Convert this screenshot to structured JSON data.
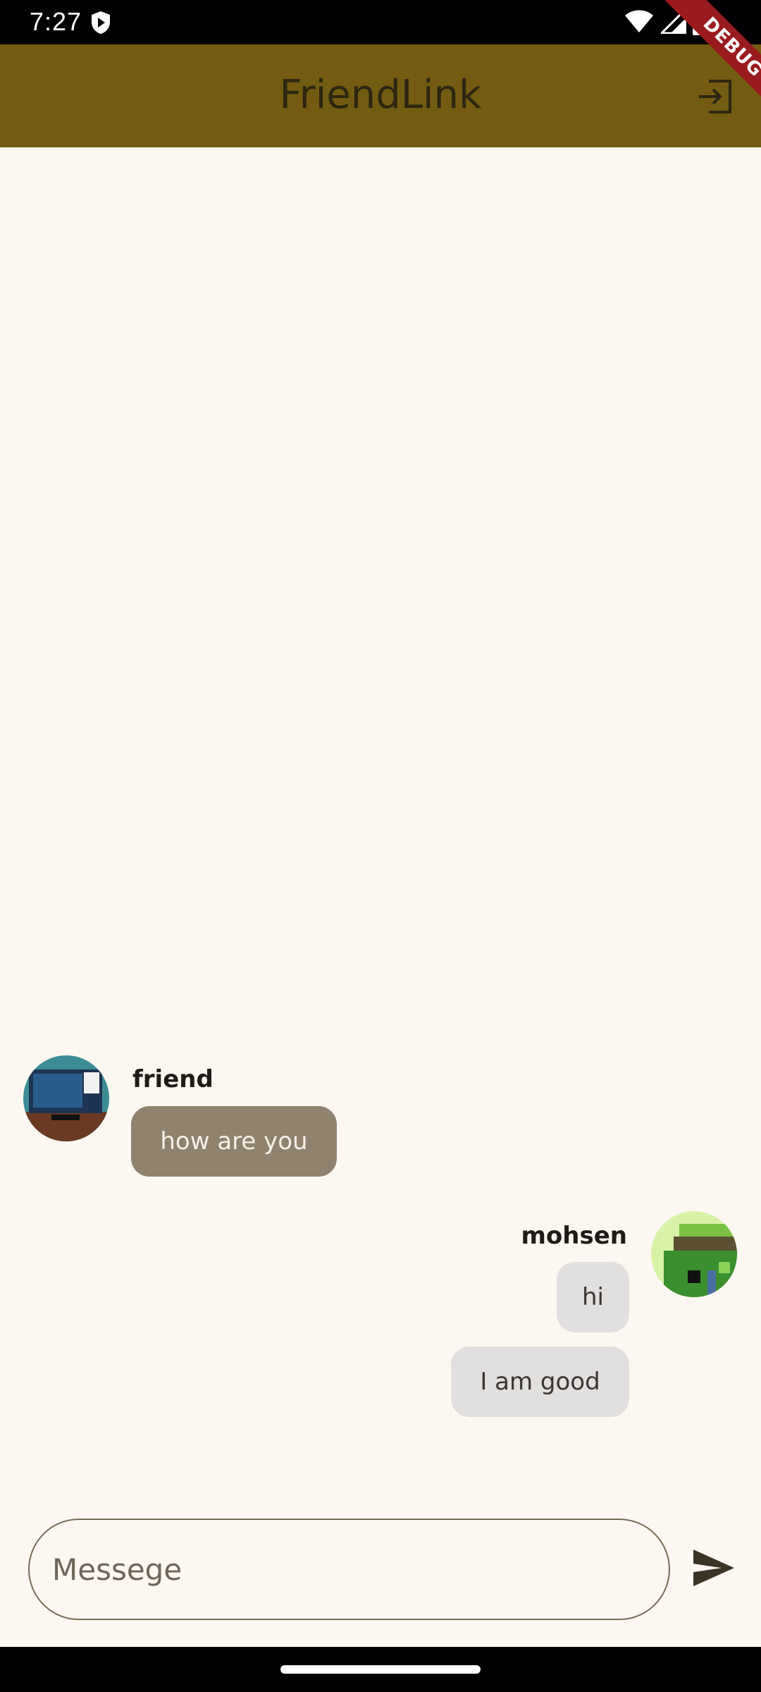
{
  "status_bar": {
    "time": "7:27"
  },
  "app_bar": {
    "title": "FriendLink",
    "debug_label": "DEBUG"
  },
  "messages": [
    {
      "sender": "friend",
      "text": "how are you"
    },
    {
      "sender": "mohsen",
      "text": "hi"
    },
    {
      "sender": "mohsen",
      "text": "I am good"
    }
  ],
  "composer": {
    "placeholder": "Messege"
  },
  "icons": {
    "logout": "logout-icon",
    "send": "send-icon",
    "wifi": "wifi-icon",
    "signal": "signal-icon",
    "battery": "battery-icon"
  },
  "colors": {
    "app_bar": "#735c11",
    "background": "#fdf7f1",
    "friend_bubble": "#8f8370",
    "my_bubble": "#e1e0df"
  }
}
